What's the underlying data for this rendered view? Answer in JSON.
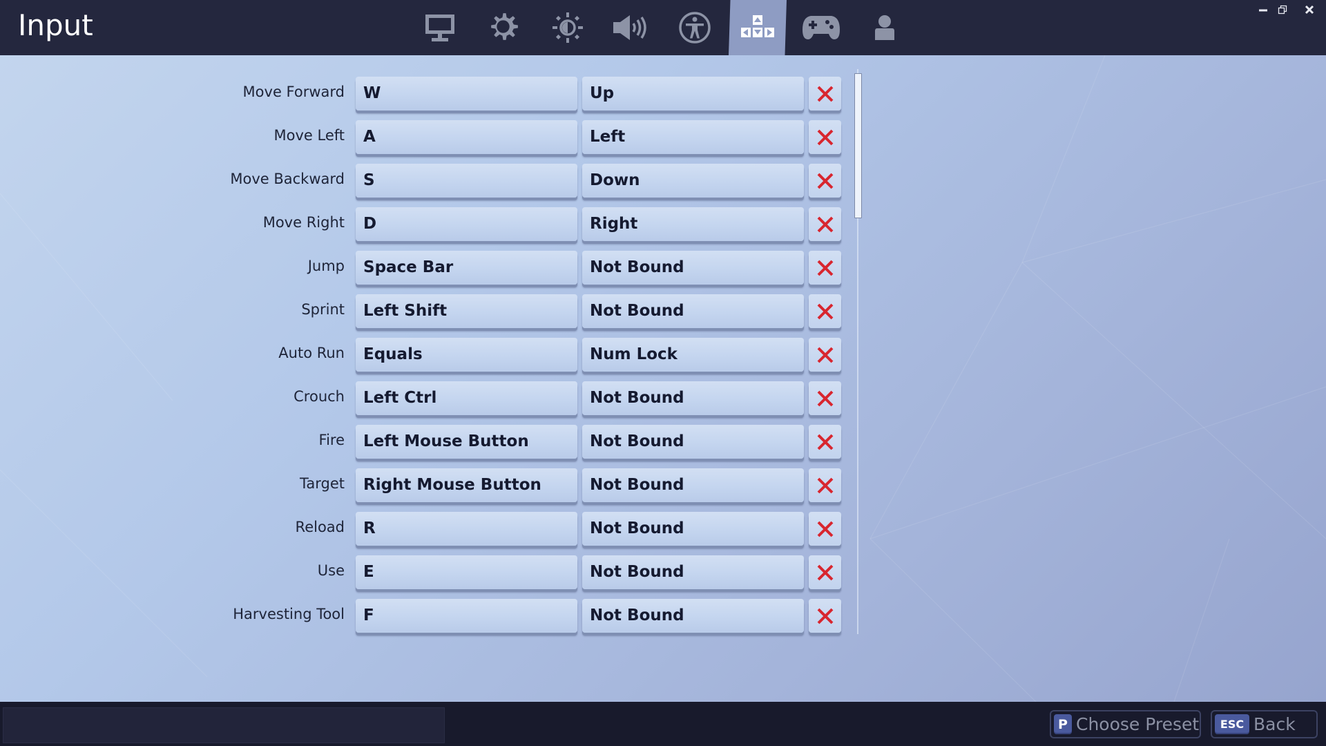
{
  "header": {
    "title": "Input",
    "tabs": [
      {
        "name": "video",
        "icon": "monitor-icon",
        "active": false
      },
      {
        "name": "game",
        "icon": "gear-icon",
        "active": false
      },
      {
        "name": "brightness",
        "icon": "brightness-icon",
        "active": false
      },
      {
        "name": "audio",
        "icon": "speaker-icon",
        "active": false
      },
      {
        "name": "accessibility",
        "icon": "accessibility-icon",
        "active": false
      },
      {
        "name": "input",
        "icon": "input-keys-icon",
        "active": true
      },
      {
        "name": "controller",
        "icon": "gamepad-icon",
        "active": false
      },
      {
        "name": "account",
        "icon": "user-icon",
        "active": false
      }
    ],
    "window_controls": [
      "minimize",
      "restore",
      "close"
    ]
  },
  "bindings": [
    {
      "action": "Move Forward",
      "primary": "W",
      "secondary": "Up"
    },
    {
      "action": "Move Left",
      "primary": "A",
      "secondary": "Left"
    },
    {
      "action": "Move Backward",
      "primary": "S",
      "secondary": "Down"
    },
    {
      "action": "Move Right",
      "primary": "D",
      "secondary": "Right"
    },
    {
      "action": "Jump",
      "primary": "Space Bar",
      "secondary": "Not Bound"
    },
    {
      "action": "Sprint",
      "primary": "Left Shift",
      "secondary": "Not Bound"
    },
    {
      "action": "Auto Run",
      "primary": "Equals",
      "secondary": "Num Lock"
    },
    {
      "action": "Crouch",
      "primary": "Left Ctrl",
      "secondary": "Not Bound"
    },
    {
      "action": "Fire",
      "primary": "Left Mouse Button",
      "secondary": "Not Bound"
    },
    {
      "action": "Target",
      "primary": "Right Mouse Button",
      "secondary": "Not Bound"
    },
    {
      "action": "Reload",
      "primary": "R",
      "secondary": "Not Bound"
    },
    {
      "action": "Use",
      "primary": "E",
      "secondary": "Not Bound"
    },
    {
      "action": "Harvesting Tool",
      "primary": "F",
      "secondary": "Not Bound"
    }
  ],
  "footer": {
    "choose_preset": {
      "key": "P",
      "label": "Choose Preset"
    },
    "back": {
      "key": "ESC",
      "label": "Back"
    }
  },
  "colors": {
    "header_bg": "#24273e",
    "active_tab": "#8e9cc3",
    "clear_x": "#d8262f",
    "footer_bg": "#181a2c",
    "key_cap": "#4a5a9e"
  }
}
